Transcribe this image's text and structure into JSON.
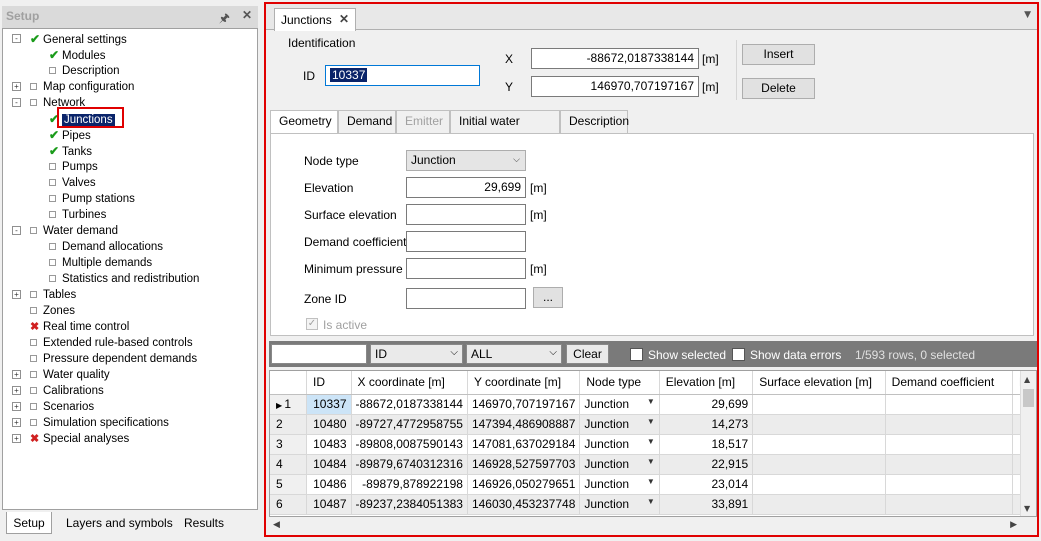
{
  "left_panel": {
    "title": "Setup",
    "pin_icon": "pin-icon",
    "close_icon": "close-icon",
    "tree": [
      {
        "label": "General settings",
        "state": "check"
      },
      {
        "label": "Modules",
        "state": "check"
      },
      {
        "label": "Description",
        "state": "box"
      },
      {
        "label": "Map configuration",
        "state": "box"
      },
      {
        "label": "Network",
        "state": "box"
      },
      {
        "label": "Junctions",
        "state": "check"
      },
      {
        "label": "Pipes",
        "state": "check"
      },
      {
        "label": "Tanks",
        "state": "check"
      },
      {
        "label": "Pumps",
        "state": "box"
      },
      {
        "label": "Valves",
        "state": "box"
      },
      {
        "label": "Pump stations",
        "state": "box"
      },
      {
        "label": "Turbines",
        "state": "box"
      },
      {
        "label": "Water demand",
        "state": "box"
      },
      {
        "label": "Demand allocations",
        "state": "box"
      },
      {
        "label": "Multiple demands",
        "state": "box"
      },
      {
        "label": "Statistics and redistribution",
        "state": "box"
      },
      {
        "label": "Tables",
        "state": "box"
      },
      {
        "label": "Zones",
        "state": "box"
      },
      {
        "label": "Real time control",
        "state": "error"
      },
      {
        "label": "Extended rule-based controls",
        "state": "box"
      },
      {
        "label": "Pressure dependent demands",
        "state": "box"
      },
      {
        "label": "Water quality",
        "state": "box"
      },
      {
        "label": "Calibrations",
        "state": "box"
      },
      {
        "label": "Scenarios",
        "state": "box"
      },
      {
        "label": "Simulation specifications",
        "state": "box"
      },
      {
        "label": "Special analyses",
        "state": "error"
      }
    ],
    "bottom_tabs": [
      "Setup",
      "Layers and symbols",
      "Results"
    ]
  },
  "document_tab": {
    "label": "Junctions"
  },
  "identification": {
    "legend": "Identification",
    "id_label": "ID",
    "id_value": "10337",
    "x_label": "X",
    "x_value": "-88672,0187338144",
    "y_label": "Y",
    "y_value": "146970,707197167",
    "unit_m": "[m]",
    "insert_label": "Insert",
    "delete_label": "Delete"
  },
  "property_tabs": [
    "Geometry",
    "Demand",
    "Emitter",
    "Initial water quality",
    "Description"
  ],
  "geometry": {
    "node_type_label": "Node type",
    "node_type_value": "Junction",
    "elevation_label": "Elevation",
    "elevation_value": "29,699",
    "surface_elevation_label": "Surface elevation",
    "demand_coefficient_label": "Demand coefficient",
    "minimum_pressure_label": "Minimum pressure",
    "zone_id_label": "Zone ID",
    "browse_label": "...",
    "is_active_label": "Is active",
    "unit_m": "[m]"
  },
  "filter_bar": {
    "search_value": "",
    "field_select": "ID",
    "scope_select": "ALL",
    "clear_label": "Clear",
    "show_selected_label": "Show selected",
    "show_errors_label": "Show data errors",
    "rows_info": "1/593 rows, 0 selected"
  },
  "grid": {
    "columns": [
      "",
      "ID",
      "X coordinate [m]",
      "Y coordinate [m]",
      "Node type",
      "Elevation [m]",
      "Surface elevation [m]",
      "Demand coefficient",
      "M"
    ],
    "rows": [
      [
        "1",
        "10337",
        "-88672,0187338144",
        "146970,707197167",
        "Junction",
        "29,699",
        "",
        ""
      ],
      [
        "2",
        "10480",
        "-89727,4772958755",
        "147394,486908887",
        "Junction",
        "14,273",
        "",
        ""
      ],
      [
        "3",
        "10483",
        "-89808,0087590143",
        "147081,637029184",
        "Junction",
        "18,517",
        "",
        ""
      ],
      [
        "4",
        "10484",
        "-89879,6740312316",
        "146928,527597703",
        "Junction",
        "22,915",
        "",
        ""
      ],
      [
        "5",
        "10486",
        "-89879,878922198",
        "146926,050279651",
        "Junction",
        "23,014",
        "",
        ""
      ],
      [
        "6",
        "10487",
        "-89237,2384051383",
        "146030,453237748",
        "Junction",
        "33,891",
        "",
        ""
      ]
    ]
  }
}
